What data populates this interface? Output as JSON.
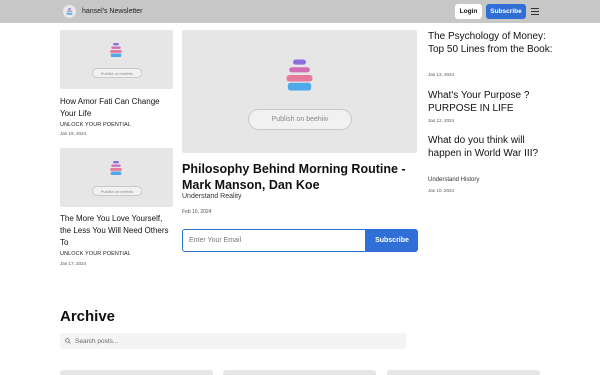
{
  "header": {
    "newsletter_name": "hansel's Newsletter",
    "login_label": "Login",
    "subscribe_label": "Subscribe",
    "logo_icon": "beehiiv-logo-icon",
    "menu_icon": "hamburger-menu-icon"
  },
  "placeholder_badge": "Publish on beehiiv",
  "posts_left": [
    {
      "title": "How Amor Fati Can Change Your Life",
      "category": "UNLOCK YOUR POENTIAL",
      "date": "Jan 19, 2024"
    },
    {
      "title": "The More You Love Yourself, the Less You Will Need Others To",
      "category": "UNLOCK YOUR POENTIAL",
      "date": "Jan 17, 2024"
    }
  ],
  "featured": {
    "title": "Philosophy Behind Morning Routine - Mark Manson, Dan Koe",
    "category": "Understand Reality",
    "date": "Feb 10, 2024"
  },
  "subscribe_form": {
    "email_placeholder": "Enter Your Email",
    "button_label": "Subscribe"
  },
  "posts_right": [
    {
      "title": "The Psychology of Money: Top 50 Lines from the Book:",
      "date": "Jan 13, 2024"
    },
    {
      "title": "What's Your Purpose ? PURPOSE IN LIFE",
      "date": "Jan 12, 2024"
    },
    {
      "title": "What do you think will happen in World War III?",
      "category": "Understand History",
      "date": "Jan 10, 2024"
    }
  ],
  "archive": {
    "title": "Archive",
    "search_placeholder": "Search posts..."
  },
  "colors": {
    "accent": "#2f6fd6",
    "header_bg": "#c7c7c7",
    "thumb_bg": "#e6e6e6"
  }
}
